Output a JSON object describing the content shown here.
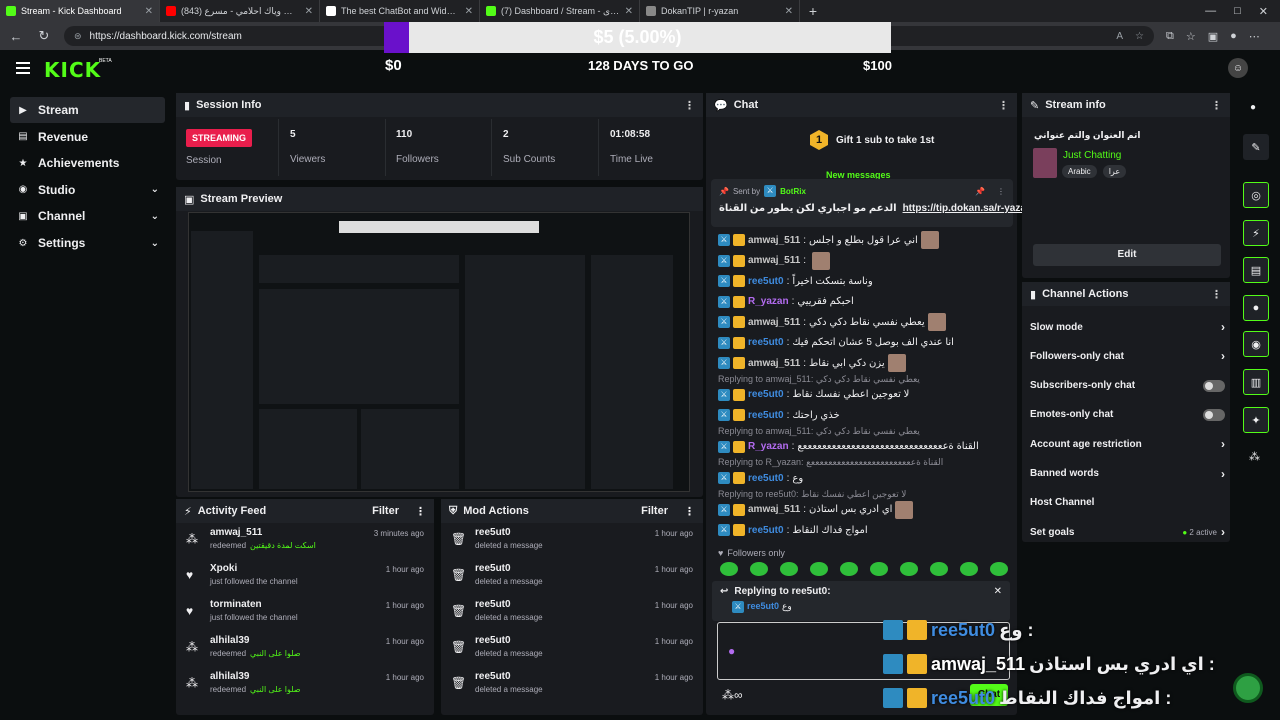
{
  "browser": {
    "tabs": [
      {
        "label": "Stream - Kick Dashboard",
        "color": "#53fc18",
        "active": true
      },
      {
        "label": "(843) ضاعت وياك احلامي - مسرع",
        "color": "#ff0000",
        "active": false
      },
      {
        "label": "The best ChatBot and Widgets fo",
        "color": "#ffffff",
        "active": false
      },
      {
        "label": "(7) Dashboard / Stream - تطوير المحتوى",
        "color": "#53fc18",
        "active": false
      },
      {
        "label": "DokanTIP | r-yazan",
        "color": "#888888",
        "active": false
      }
    ],
    "url": "https://dashboard.kick.com/stream"
  },
  "goal": {
    "text": "$5 (5.00%)",
    "start": "$0",
    "days": "128 DAYS TO GO",
    "end": "$100",
    "progress": 0.05
  },
  "logo": {
    "text": "KICK",
    "beta": "BETA"
  },
  "sidebar": {
    "items": [
      {
        "label": "Stream",
        "icon": "video-icon",
        "glyph": "▶",
        "active": true,
        "chevron": false
      },
      {
        "label": "Revenue",
        "icon": "revenue-icon",
        "glyph": "▤",
        "active": false,
        "chevron": false
      },
      {
        "label": "Achievements",
        "icon": "achievements-icon",
        "glyph": "★",
        "active": false,
        "chevron": false
      },
      {
        "label": "Studio",
        "icon": "studio-icon",
        "glyph": "◉",
        "active": false,
        "chevron": true
      },
      {
        "label": "Channel",
        "icon": "channel-icon",
        "glyph": "▣",
        "active": false,
        "chevron": true
      },
      {
        "label": "Settings",
        "icon": "gear-icon",
        "glyph": "⚙",
        "active": false,
        "chevron": true
      }
    ]
  },
  "session": {
    "title": "Session Info",
    "badge": "STREAMING",
    "badge_label": "Session",
    "stats": [
      {
        "value": "5",
        "label": "Viewers"
      },
      {
        "value": "110",
        "label": "Followers"
      },
      {
        "value": "2",
        "label": "Sub Counts"
      },
      {
        "value": "01:08:58",
        "label": "Time Live"
      }
    ]
  },
  "preview": {
    "title": "Stream Preview"
  },
  "activity": {
    "title": "Activity Feed",
    "filter": "Filter",
    "items": [
      {
        "name": "amwaj_511",
        "sub": "redeemed",
        "extra": "اسكت لمدة دقيقتين",
        "time": "3 minutes ago",
        "icon": "redeem-icon",
        "glyph": "⁂"
      },
      {
        "name": "Xpoki",
        "sub": "just followed the channel",
        "extra": "",
        "time": "1 hour ago",
        "icon": "heart-icon",
        "glyph": "♥"
      },
      {
        "name": "torminaten",
        "sub": "just followed the channel",
        "extra": "",
        "time": "1 hour ago",
        "icon": "heart-icon",
        "glyph": "♥"
      },
      {
        "name": "alhilal39",
        "sub": "redeemed",
        "extra": "صلوا على النبي",
        "time": "1 hour ago",
        "icon": "redeem-icon",
        "glyph": "⁂"
      },
      {
        "name": "alhilal39",
        "sub": "redeemed",
        "extra": "صلوا على النبي",
        "time": "1 hour ago",
        "icon": "redeem-icon",
        "glyph": "⁂"
      }
    ]
  },
  "mod": {
    "title": "Mod Actions",
    "filter": "Filter",
    "items": [
      {
        "name": "ree5ut0",
        "sub": "deleted a message",
        "time": "1 hour ago"
      },
      {
        "name": "ree5ut0",
        "sub": "deleted a message",
        "time": "1 hour ago"
      },
      {
        "name": "ree5ut0",
        "sub": "deleted a message",
        "time": "1 hour ago"
      },
      {
        "name": "ree5ut0",
        "sub": "deleted a message",
        "time": "1 hour ago"
      },
      {
        "name": "ree5ut0",
        "sub": "deleted a message",
        "time": "1 hour ago"
      }
    ]
  },
  "chat": {
    "title": "Chat",
    "gift": "Gift 1 sub to take 1st",
    "gift_num": "1",
    "new_messages": "New messages",
    "pinned_sent_by": "Sent by",
    "pinned_bot": "BotRix",
    "pinned_text": "الدعم مو اجباري لكن يطور من القناة",
    "pinned_link": "https://tip.dokan.sa/r-yazan",
    "messages": [
      {
        "type": "msg",
        "user": "amwaj_511",
        "color": "#c9c9c9",
        "text": "اني عرا قول بطلع و اجلس",
        "emote": true
      },
      {
        "type": "msg",
        "user": "amwaj_511",
        "color": "#c9c9c9",
        "text": "",
        "emote": true
      },
      {
        "type": "msg",
        "user": "ree5ut0",
        "color": "#3f8ce0",
        "text": "وناسة بتسكت اخيراً",
        "emote": false
      },
      {
        "type": "msg",
        "user": "R_yazan",
        "color": "#b36cf0",
        "text": "احبكم فقرييي",
        "emote": false
      },
      {
        "type": "msg",
        "user": "amwaj_511",
        "color": "#c9c9c9",
        "text": "يعطي نفسي نقاط دكي دكي",
        "emote": true
      },
      {
        "type": "msg",
        "user": "ree5ut0",
        "color": "#3f8ce0",
        "text": "انا عندي الف بوصل 5 عشان اتحكم فيك",
        "emote": false
      },
      {
        "type": "msg",
        "user": "amwaj_511",
        "color": "#c9c9c9",
        "text": "يزن دكي ابي نقاط",
        "emote": true
      },
      {
        "type": "reply",
        "text": "Replying to amwaj_511: يعطي نفسي نقاط دكي دكي"
      },
      {
        "type": "msg",
        "user": "ree5ut0",
        "color": "#3f8ce0",
        "text": "لا تعوجين اعطي نفسك نقاط",
        "emote": false
      },
      {
        "type": "msg",
        "user": "ree5ut0",
        "color": "#3f8ce0",
        "text": "خذي راحتك",
        "emote": false
      },
      {
        "type": "reply",
        "text": "Replying to amwaj_511: يعطي نفسي نقاط دكي دكي"
      },
      {
        "type": "msg",
        "user": "R_yazan",
        "color": "#b36cf0",
        "text": "القناة ةععععععععععععععععععععععععععععععع",
        "emote": false
      },
      {
        "type": "reply",
        "text": "Replying to R_yazan: القناة ةععععععععععععععععععععععععع"
      },
      {
        "type": "msg",
        "user": "ree5ut0",
        "color": "#3f8ce0",
        "text": "وع",
        "emote": false
      },
      {
        "type": "reply",
        "text": "Replying to ree5ut0: لا تعوجين اعطي نفسك نقاط"
      },
      {
        "type": "msg",
        "user": "amwaj_511",
        "color": "#c9c9c9",
        "text": "اي ادري بس استاذن",
        "emote": true
      },
      {
        "type": "msg",
        "user": "ree5ut0",
        "color": "#3f8ce0",
        "text": "امواج فداك النقاط",
        "emote": false
      }
    ],
    "followers_only": "Followers only",
    "replying_to": "Replying to ree5ut0:",
    "reply_preview_user": "ree5ut0",
    "reply_preview_text": "وع",
    "send_label": "Chat"
  },
  "stream_info": {
    "title": "Stream info",
    "stream_title": "اتم العنوان والتم عنواني",
    "category": "Just Chatting",
    "tags": [
      "Arabic",
      "عرا"
    ],
    "edit": "Edit"
  },
  "channel_actions": {
    "title": "Channel Actions",
    "rows": [
      {
        "label": "Slow mode",
        "kind": "arrow"
      },
      {
        "label": "Followers-only chat",
        "kind": "arrow"
      },
      {
        "label": "Subscribers-only chat",
        "kind": "toggle"
      },
      {
        "label": "Emotes-only chat",
        "kind": "toggle"
      },
      {
        "label": "Account age restriction",
        "kind": "arrow"
      },
      {
        "label": "Banned words",
        "kind": "arrow"
      },
      {
        "label": "Host Channel",
        "kind": "none"
      },
      {
        "label": "Set goals",
        "kind": "goals",
        "extra": "2 active"
      }
    ]
  },
  "overlay_chat": [
    {
      "user": "ree5ut0",
      "color": "#3f8ce0",
      "text": "وع :"
    },
    {
      "user": "amwaj_511",
      "color": "#ffffff",
      "text": "اي ادري بس استاذن :"
    },
    {
      "user": "ree5ut0",
      "color": "#3f8ce0",
      "text": "امواج فداك النقاط :"
    }
  ]
}
